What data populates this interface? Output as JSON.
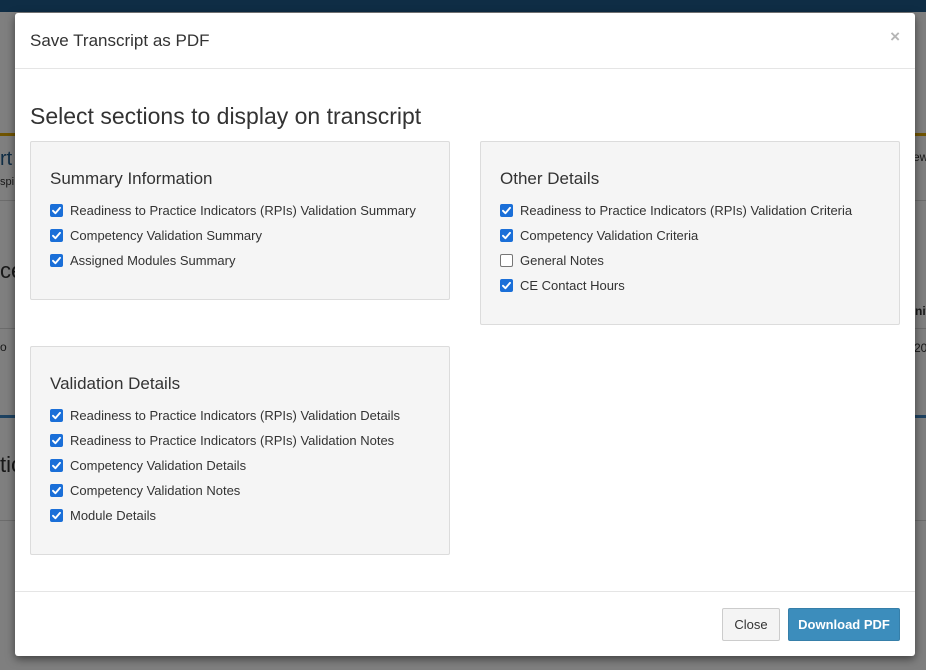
{
  "background": {
    "fragments": [
      "rt",
      "spi",
      "ce",
      "o",
      "tic",
      "ew",
      "nit",
      "20"
    ]
  },
  "modal": {
    "title": "Save Transcript as PDF",
    "close_glyph": "×",
    "heading": "Select sections to display on transcript",
    "panels": {
      "summary": {
        "title": "Summary Information",
        "items": [
          {
            "label": "Readiness to Practice Indicators (RPIs) Validation Summary",
            "checked": true
          },
          {
            "label": "Competency Validation Summary",
            "checked": true
          },
          {
            "label": "Assigned Modules Summary",
            "checked": true
          }
        ]
      },
      "other": {
        "title": "Other Details",
        "items": [
          {
            "label": "Readiness to Practice Indicators (RPIs) Validation Criteria",
            "checked": true
          },
          {
            "label": "Competency Validation Criteria",
            "checked": true
          },
          {
            "label": "General Notes",
            "checked": false
          },
          {
            "label": "CE Contact Hours",
            "checked": true
          }
        ]
      },
      "validation": {
        "title": "Validation Details",
        "items": [
          {
            "label": "Readiness to Practice Indicators (RPIs) Validation Details",
            "checked": true
          },
          {
            "label": "Readiness to Practice Indicators (RPIs) Validation Notes",
            "checked": true
          },
          {
            "label": "Competency Validation Details",
            "checked": true
          },
          {
            "label": "Competency Validation Notes",
            "checked": true
          },
          {
            "label": "Module Details",
            "checked": true
          }
        ]
      }
    },
    "footer": {
      "close_label": "Close",
      "download_label": "Download PDF"
    }
  },
  "colors": {
    "checkbox_on": "#1a6fd8",
    "primary_button": "#3c8dbc",
    "topbar": "#1f5a8a"
  }
}
